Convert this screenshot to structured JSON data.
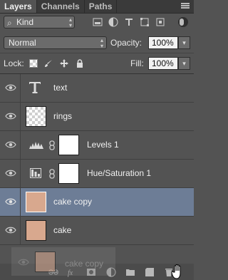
{
  "tabs": [
    {
      "label": "Layers",
      "active": true
    },
    {
      "label": "Channels",
      "active": false
    },
    {
      "label": "Paths",
      "active": false
    }
  ],
  "filter": {
    "kind_label": "Kind"
  },
  "blend": {
    "mode": "Normal",
    "opacity_label": "Opacity:",
    "opacity_value": "100%"
  },
  "lock": {
    "label": "Lock:",
    "fill_label": "Fill:",
    "fill_value": "100%"
  },
  "layers": [
    {
      "name": "text",
      "type": "text",
      "visible": true,
      "selected": false
    },
    {
      "name": "rings",
      "type": "pixel",
      "visible": true,
      "selected": false
    },
    {
      "name": "Levels 1",
      "type": "adjustment",
      "icon": "levels-icon",
      "visible": true,
      "selected": false
    },
    {
      "name": "Hue/Saturation 1",
      "type": "adjustment",
      "icon": "hue-saturation-icon",
      "visible": true,
      "selected": false
    },
    {
      "name": "cake copy",
      "type": "pixel",
      "visible": true,
      "selected": true
    },
    {
      "name": "cake",
      "type": "pixel",
      "visible": true,
      "selected": false
    }
  ],
  "drag_ghost": {
    "name": "cake copy"
  },
  "bottom_icons": [
    "link-layers-icon",
    "fx-icon",
    "mask-icon",
    "adjustment-icon",
    "group-icon",
    "new-layer-icon",
    "trash-icon"
  ],
  "colors": {
    "panel": "#535353",
    "selected": "#6d7d96",
    "tab_bar": "#3a3a3a"
  }
}
